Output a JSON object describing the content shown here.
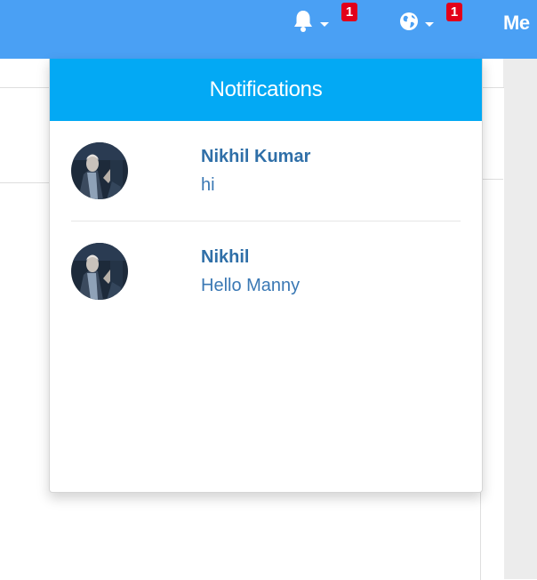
{
  "navbar": {
    "bell_icon": "bell-icon",
    "bell_badge": "1",
    "globe_icon": "globe-icon",
    "globe_badge": "1",
    "me_label": "Me"
  },
  "notifications": {
    "header": "Notifications",
    "items": [
      {
        "name": "Nikhil Kumar",
        "message": "hi",
        "avatar_icon": "user-avatar"
      },
      {
        "name": "Nikhil",
        "message": "Hello Manny",
        "avatar_icon": "user-avatar"
      }
    ]
  },
  "colors": {
    "navbar_bg": "#4aa0f4",
    "header_bg": "#03a9f4",
    "badge_bg": "#e2001a",
    "name_text": "#2f6fa8",
    "message_text": "#3a78b4"
  }
}
